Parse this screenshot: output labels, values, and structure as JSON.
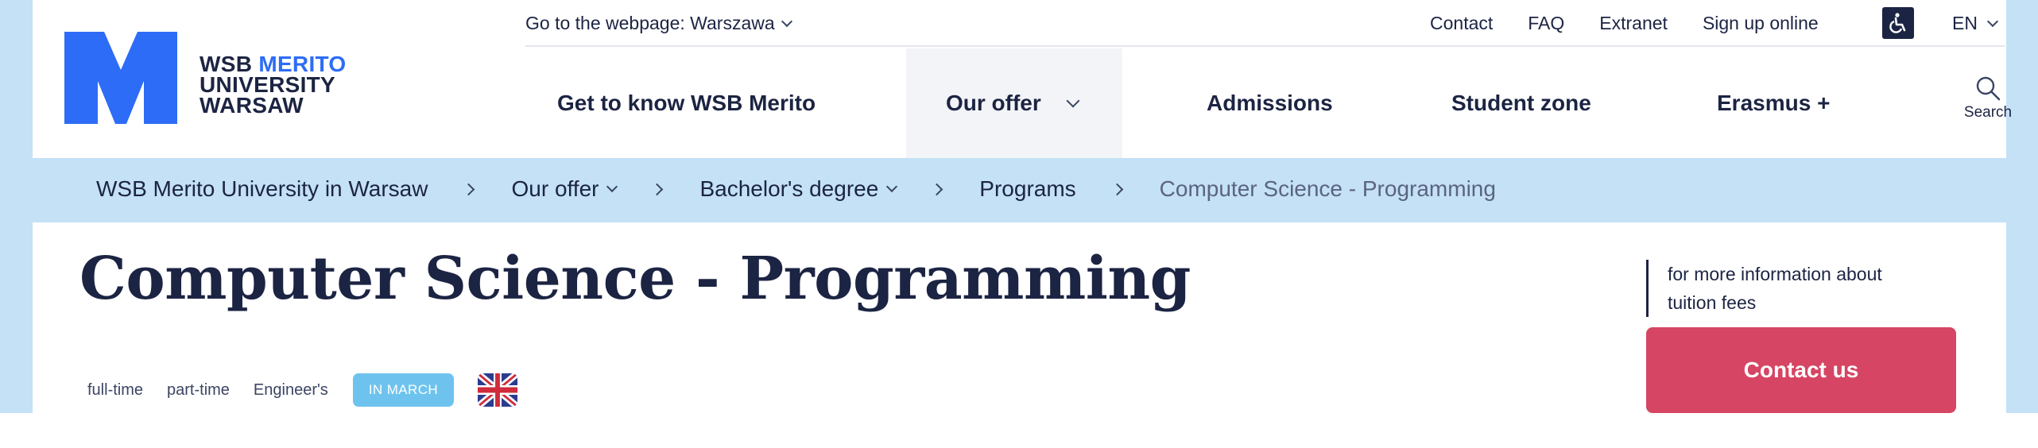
{
  "logo": {
    "line1_a": "WSB",
    "line1_b": "MERITO",
    "line2": "UNIVERSITY",
    "line3": "WARSAW"
  },
  "topbar": {
    "goto_label": "Go to the webpage: Warszawa",
    "links": [
      "Contact",
      "FAQ",
      "Extranet",
      "Sign up online"
    ],
    "language": "EN"
  },
  "nav": {
    "items": [
      "Get to know WSB Merito",
      "Our offer",
      "Admissions",
      "Student zone",
      "Erasmus +"
    ],
    "active": "Our offer",
    "search_label": "Search"
  },
  "breadcrumb": {
    "items": [
      "WSB Merito University in Warsaw",
      "Our offer",
      "Bachelor's degree",
      "Programs",
      "Computer Science - Programming"
    ]
  },
  "content": {
    "title": "Computer Science - Programming",
    "tags": [
      "full-time",
      "part-time",
      "Engineer's"
    ],
    "badge": "IN MARCH",
    "info_text": "for more information about tuition fees",
    "contact_button": "Contact us"
  },
  "colors": {
    "brand_blue": "#2d6cf6",
    "navy": "#1c2443",
    "light_blue_bg": "#c4e1f6",
    "badge_blue": "#6ec3ee",
    "cta_red": "#d64563"
  }
}
